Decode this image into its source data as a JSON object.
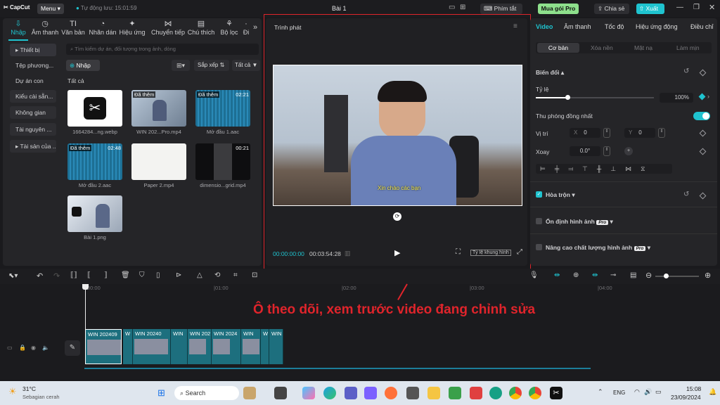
{
  "colors": {
    "accent": "#1fc3cf",
    "annotation_red": "#e0242b",
    "brand_teal": "#1fc3cf",
    "pro_green": "#8ee08c"
  },
  "topbar": {
    "logo": "CapCut",
    "menu": "Menu",
    "autosave": "Tự động lưu: 15:01:59",
    "project_title": "Bài 1",
    "shortcuts": "Phím tắt",
    "buy_pro": "Mua gói Pro",
    "share": "Chia sẻ",
    "export": "Xuất"
  },
  "left_panel": {
    "tabs": [
      {
        "label": "Nhập",
        "icon": "import-icon"
      },
      {
        "label": "Âm thanh",
        "icon": "audio-icon"
      },
      {
        "label": "Văn bản",
        "icon": "text-icon"
      },
      {
        "label": "Nhãn dán",
        "icon": "sticker-icon"
      },
      {
        "label": "Hiệu ứng",
        "icon": "effects-icon"
      },
      {
        "label": "Chuyển tiếp",
        "icon": "transition-icon"
      },
      {
        "label": "Chú thích",
        "icon": "caption-icon"
      },
      {
        "label": "Bộ lọc",
        "icon": "filter-icon"
      },
      {
        "label": "Đi",
        "icon": "more-icon"
      }
    ],
    "sidebar": [
      "Thiết bị",
      "Tệp phương...",
      "Dự án con",
      "Kiểu cài sẵn...",
      "Không gian",
      "Tài nguyên ...",
      "Tài sản của ..."
    ],
    "search_placeholder": "Tìm kiếm dự án, đối tượng trong ảnh, dòng",
    "import_button": "Nhập",
    "sort_button": "Sắp xếp",
    "all_filter": "Tất cả",
    "section_title": "Tất cả",
    "media": [
      {
        "caption": "1664284...ng.webp",
        "added": "",
        "duration": ""
      },
      {
        "caption": "WIN 202...Pro.mp4",
        "added": "Đã thêm",
        "duration": ""
      },
      {
        "caption": "Mở đầu 1.aac",
        "added": "Đã thêm",
        "duration": "02:21"
      },
      {
        "caption": "Mở đầu 2.aac",
        "added": "Đã thêm",
        "duration": "02:48"
      },
      {
        "caption": "Paper 2.mp4",
        "added": "",
        "duration": ""
      },
      {
        "caption": "dimensio...grid.mp4",
        "added": "",
        "duration": "00:21"
      },
      {
        "caption": "Bài 1.png",
        "added": "",
        "duration": ""
      }
    ]
  },
  "player": {
    "title": "Trình phát",
    "subtitle": "Xin chào các bạn",
    "current_time": "00:00:00:00",
    "total_time": "00:03:54:28",
    "ratio_button": "Tỷ lệ khung hình"
  },
  "right_panel": {
    "tabs": [
      "Video",
      "Âm thanh",
      "Tốc độ",
      "Hiệu ứng động",
      "Điều chỉ"
    ],
    "subtabs": [
      "Cơ bản",
      "Xóa nền",
      "Mặt nạ",
      "Làm mịn"
    ],
    "transform_title": "Biến đổi",
    "scale_label": "Tỷ lệ",
    "scale_value": "100%",
    "scale_fraction": 0.27,
    "uniform_scale": "Thu phóng đồng nhất",
    "position_label": "Vị trí",
    "pos_x_label": "X",
    "pos_x": "0",
    "pos_y_label": "Y",
    "pos_y": "0",
    "rotate_label": "Xoay",
    "rotate_value": "0.0°",
    "blend": "Hòa trộn",
    "stabilize": "Ổn định hình ảnh",
    "enhance": "Nâng cao chất lượng hình ảnh",
    "pro_badge": "Pro"
  },
  "timeline": {
    "ticks": [
      "00:00",
      "|01:00",
      "|02:00",
      "|03:00",
      "|04:00"
    ],
    "annotation": "Ô theo dõi, xem trước video đang chỉnh sửa",
    "clips": [
      "WIN 202409",
      "W",
      "WIN 20240",
      "WIN",
      "WIN 202",
      "WIN 2024",
      "WIN",
      "W",
      "WIN"
    ]
  },
  "taskbar": {
    "weather_temp": "31°C",
    "weather_desc": "Sebagian cerah",
    "search": "Search",
    "lang": "ENG",
    "time": "15:08",
    "date": "23/09/2024"
  }
}
